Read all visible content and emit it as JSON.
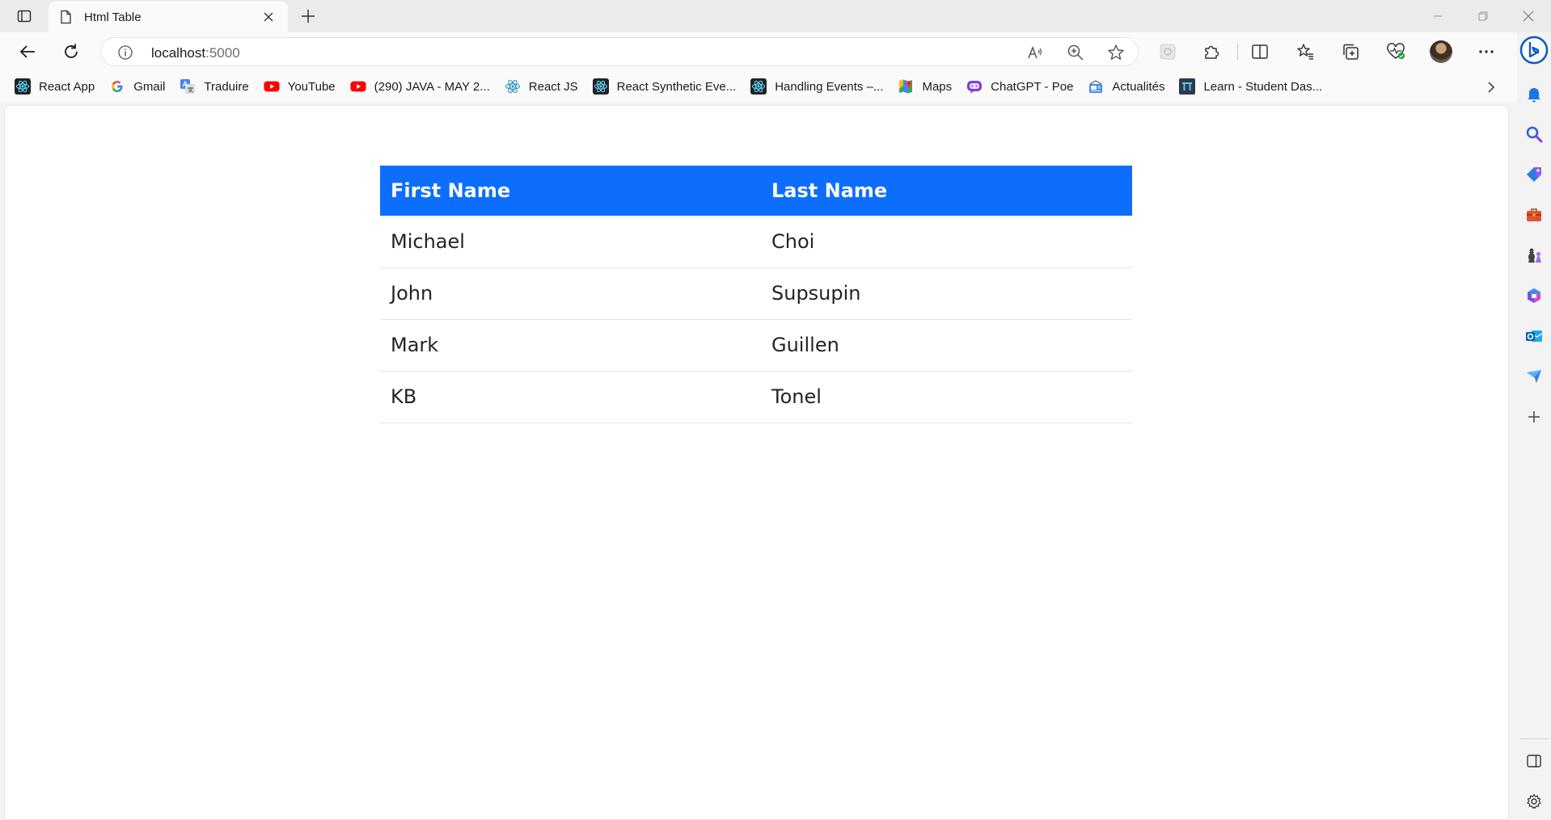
{
  "browser": {
    "tab": {
      "title": "Html Table",
      "favicon": "page-icon"
    },
    "address_bar": {
      "host": "localhost",
      "port": ":5000"
    },
    "bookmarks": [
      {
        "label": "React App",
        "icon": "react-icon"
      },
      {
        "label": "Gmail",
        "icon": "google-icon"
      },
      {
        "label": "Traduire",
        "icon": "translate-icon"
      },
      {
        "label": "YouTube",
        "icon": "youtube-icon"
      },
      {
        "label": "(290) JAVA - MAY 2...",
        "icon": "youtube-icon"
      },
      {
        "label": "React JS",
        "icon": "react-icon"
      },
      {
        "label": "React Synthetic Eve...",
        "icon": "react-icon"
      },
      {
        "label": "Handling Events –...",
        "icon": "react-icon"
      },
      {
        "label": "Maps",
        "icon": "maps-icon"
      },
      {
        "label": "ChatGPT - Poe",
        "icon": "poe-icon"
      },
      {
        "label": "Actualités",
        "icon": "news-icon"
      },
      {
        "label": "Learn - Student Das...",
        "icon": "learn-icon"
      }
    ]
  },
  "table": {
    "headers": {
      "first": "First Name",
      "last": "Last Name"
    },
    "rows": [
      {
        "first": "Michael",
        "last": "Choi"
      },
      {
        "first": "John",
        "last": "Supsupin"
      },
      {
        "first": "Mark",
        "last": "Guillen"
      },
      {
        "first": "KB",
        "last": "Tonel"
      }
    ]
  },
  "colors": {
    "table_header_bg": "#0d6efd",
    "table_header_text": "#ffffff",
    "row_border": "#dee2e6",
    "edge_accent": "#0c59c4"
  }
}
